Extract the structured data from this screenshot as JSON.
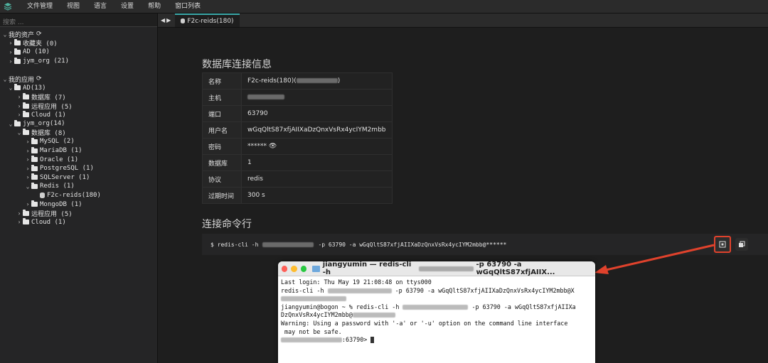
{
  "menubar": {
    "items": [
      "文件管理",
      "视图",
      "语言",
      "设置",
      "帮助",
      "窗口列表"
    ]
  },
  "sidebar": {
    "search_placeholder": "搜索 ...",
    "my_assets": "我的资产",
    "favorites": "收藏夹 (0)",
    "ad_assets": "AD (10)",
    "jym_org_assets": "jym_org (21)",
    "my_apps": "我的应用",
    "ad_apps": "AD(13)",
    "ad_db": "数据库 (7)",
    "ad_remote": "远程应用 (5)",
    "ad_cloud": "Cloud (1)",
    "jym_org_apps": "jym_org(14)",
    "jym_db": "数据库 (8)",
    "mysql": "MySQL (2)",
    "mariadb": "MariaDB (1)",
    "oracle": "Oracle (1)",
    "postgresql": "PostgreSQL (1)",
    "sqlserver": "SQLServer (1)",
    "redis": "Redis (1)",
    "redis_item": "F2c-reids(180)",
    "mongodb": "MongoDB (1)",
    "jym_remote": "远程应用 (5)",
    "jym_cloud": "Cloud (1)"
  },
  "tab": {
    "label": "F2c-reids(180)"
  },
  "connection": {
    "title": "数据库连接信息",
    "rows": [
      {
        "key": "名称",
        "value": "F2c-reids(180)("
      },
      {
        "key": "主机",
        "value": ""
      },
      {
        "key": "端口",
        "value": "63790"
      },
      {
        "key": "用户名",
        "value": "wGqQltS87xfjAIIXaDzQnxVsRx4ycIYM2mbb"
      },
      {
        "key": "密码",
        "value": "******"
      },
      {
        "key": "数据库",
        "value": "1"
      },
      {
        "key": "协议",
        "value": "redis"
      },
      {
        "key": "过期时间",
        "value": "300 s"
      }
    ],
    "name_suffix": ")"
  },
  "cmdline": {
    "title": "连接命令行",
    "prefix": "$ redis-cli -h",
    "rest": "-p 63790 -a wGqQltS87xfjAIIXaDzQnxVsRx4ycIYM2mbb@******"
  },
  "terminal": {
    "title_user": "jiangyumin — redis-cli -h",
    "title_rest": "-p 63790 -a wGqQltS87xfjAIIX...",
    "line1": "Last login: Thu May 19 21:08:48 on ttys000",
    "line2a": "redis-cli -h",
    "line2b": "-p 63790 -a wGqQltS87xfjAIIXaDzQnxVsRx4ycIYM2mbb@X",
    "line4a": "jiangyumin@bogon ~ % redis-cli -h",
    "line4b": "-p 63790 -a wGqQltS87xfjAIIXa",
    "line5": "DzQnxVsRx4ycIYM2mbb@",
    "line6": "Warning: Using a password with '-a' or '-u' option on the command line interface",
    "line7": " may not be safe.",
    "prompt": ":63790> "
  },
  "colors": {
    "accent": "#3aa9a9",
    "highlight": "#e0422c"
  }
}
